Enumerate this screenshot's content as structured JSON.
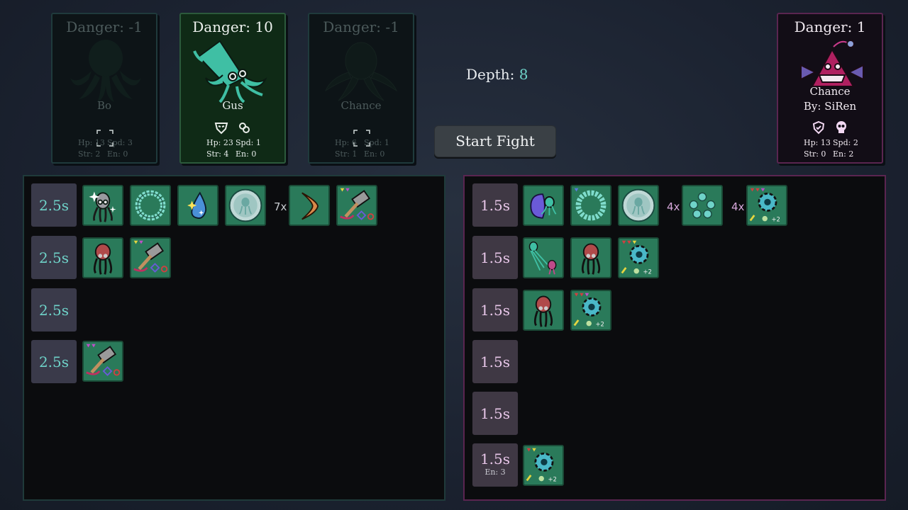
{
  "cards": {
    "bo": {
      "danger": "Danger: -1",
      "name": "Bo",
      "hp": "Hp: 13",
      "spd": "Spd: 3",
      "str": "Str: 2",
      "en": "En: 0"
    },
    "gus": {
      "danger": "Danger: 10",
      "name": "Gus",
      "hp": "Hp: 23",
      "spd": "Spd: 1",
      "str": "Str: 4",
      "en": "En: 0"
    },
    "chance_placeholder": {
      "danger": "Danger: -1",
      "name": "Chance",
      "hp": "Hp: 6",
      "spd": "Spd: 1",
      "str": "Str: 1",
      "en": "En: 0"
    },
    "enemy": {
      "danger": "Danger: 1",
      "name": "Chance",
      "author": "By: SiRen",
      "hp": "Hp: 13",
      "spd": "Spd: 2",
      "str": "Str: 0",
      "en": "En: 2"
    }
  },
  "depth": {
    "label": "Depth:",
    "value": "8"
  },
  "start_fight_label": "Start Fight",
  "left_panel": {
    "slots": [
      "2.5s",
      "2.5s",
      "2.5s",
      "2.5s"
    ],
    "multipliers": [
      "7x"
    ]
  },
  "right_panel": {
    "slots": [
      "1.5s",
      "1.5s",
      "1.5s",
      "1.5s",
      "1.5s",
      "1.5s"
    ],
    "last_slot_energy": "En: 3",
    "multipliers": [
      "4x",
      "4x"
    ],
    "gear_bonus": "+2"
  },
  "colors": {
    "player_accent": "#6fd3c9",
    "enemy_accent": "#e7c6e8",
    "item_green": "#2a7a5a",
    "enemy_border": "#5a2550"
  }
}
